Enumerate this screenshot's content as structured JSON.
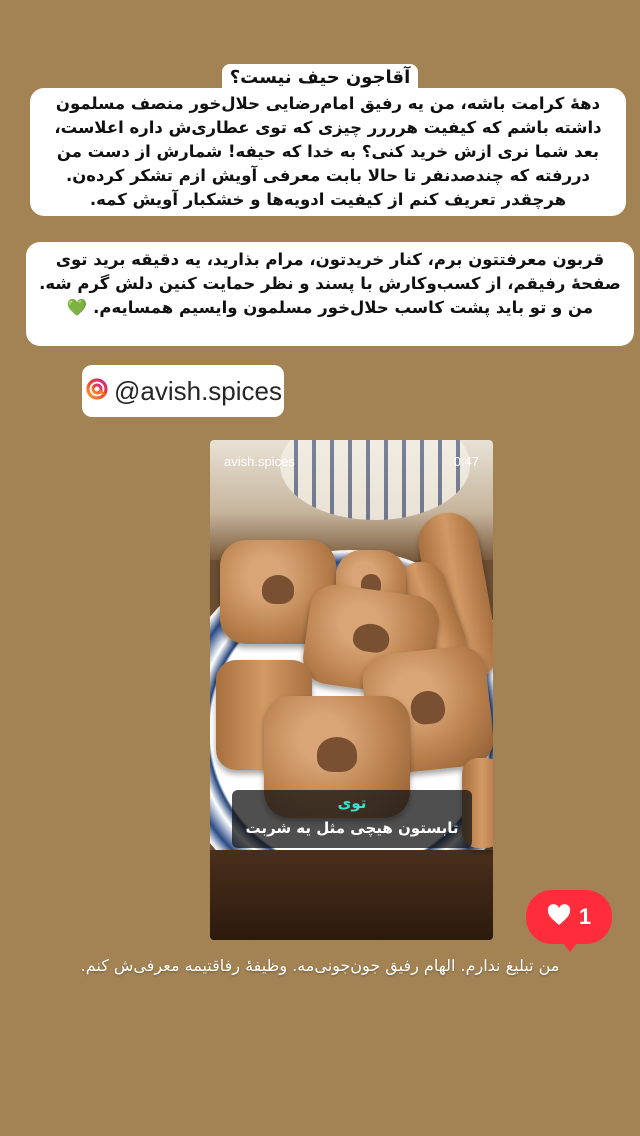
{
  "story": {
    "question": "آقاجون حیف نیست؟",
    "paragraph_1": [
      "دهۀ کرامت باشه، من یه رفیق امام‌رضایی حلال‌خور منصف مسلمون",
      "داشته باشم که کیفیت هرررر چیزی که توی عطاری‌ش داره اعلاست،",
      "بعد شما نری ازش خرید کنی؟ به خدا که حیفه! شمارش از دست من",
      "دررفته که چندصدنفر تا حالا بابت معرفی آویش ازم تشکر کرده‌ن.",
      "هرچقدر تعریف کنم از کیفیت ادویه‌ها و خشکبار آویش کمه."
    ],
    "paragraph_2": [
      "قربون معرفتتون برم، کنار خریدتون، مرام بذارید، یه دقیقه برید توی",
      "صفحۀ رفیقم، از کسب‌وکارش با پسند و نظر حمایت کنین دلش گرم شه.",
      "من و تو باید پشت کاسب حلال‌خور مسلمون وایسیم همسایه‌م. 💚"
    ],
    "mention": "@avish.spices",
    "video": {
      "username": "avish.spices",
      "duration": "0:47",
      "caption_line_1": "توی",
      "caption_line_2": "تابستون هیچی مثل یه شربت"
    },
    "like_count": "1",
    "footer": "من تبلیغ ندارم. الهام رفیق جون‌جونی‌مه. وظیفۀ رفاقتیمه معرفی‌ش کنم."
  },
  "colors": {
    "background": "#a38354",
    "like_badge": "#ff2d3c",
    "caption_accent": "#3fe0d0"
  },
  "icons": [
    "threads-icon",
    "heart-icon"
  ]
}
